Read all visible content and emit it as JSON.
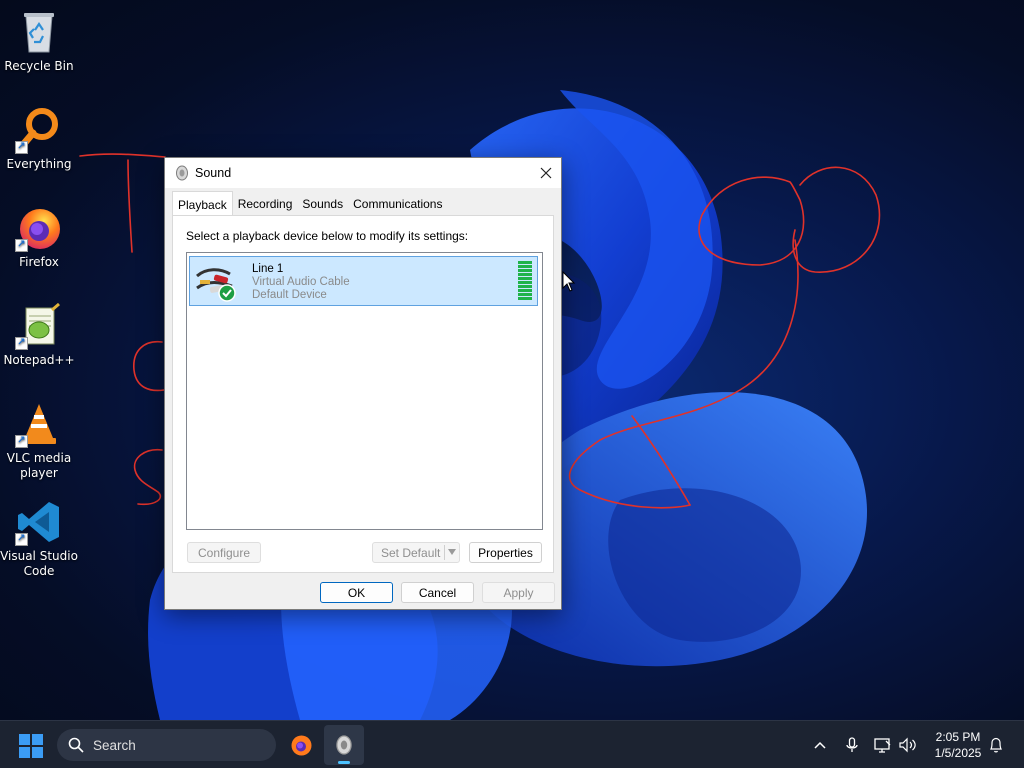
{
  "desktop": {
    "icons": [
      {
        "label": "Recycle Bin",
        "icon": "recycle-bin-icon"
      },
      {
        "label": "Everything",
        "icon": "everything-search-icon"
      },
      {
        "label": "Firefox",
        "icon": "firefox-icon"
      },
      {
        "label": "Notepad++",
        "icon": "notepad-plus-plus-icon"
      },
      {
        "label": "VLC media player",
        "icon": "vlc-icon"
      },
      {
        "label": "Visual Studio Code",
        "icon": "vscode-icon"
      }
    ]
  },
  "dialog": {
    "title": "Sound",
    "tabs": [
      "Playback",
      "Recording",
      "Sounds",
      "Communications"
    ],
    "active_tab": "Playback",
    "instruction": "Select a playback device below to modify its settings:",
    "devices": [
      {
        "name": "Line 1",
        "description": "Virtual Audio Cable",
        "status": "Default Device",
        "is_default": true,
        "selected": true
      }
    ],
    "buttons": {
      "configure": "Configure",
      "set_default": "Set Default",
      "properties": "Properties",
      "ok": "OK",
      "cancel": "Cancel",
      "apply": "Apply"
    }
  },
  "taskbar": {
    "search_label": "Search",
    "clock_time": "2:05 PM",
    "clock_date": "1/5/2025",
    "apps": [
      "firefox-icon",
      "sound-settings-icon"
    ]
  },
  "colors": {
    "accent": "#0067c0",
    "selection": "#cce8ff",
    "meter": "#20b34a",
    "annotation": "#e0322a"
  }
}
